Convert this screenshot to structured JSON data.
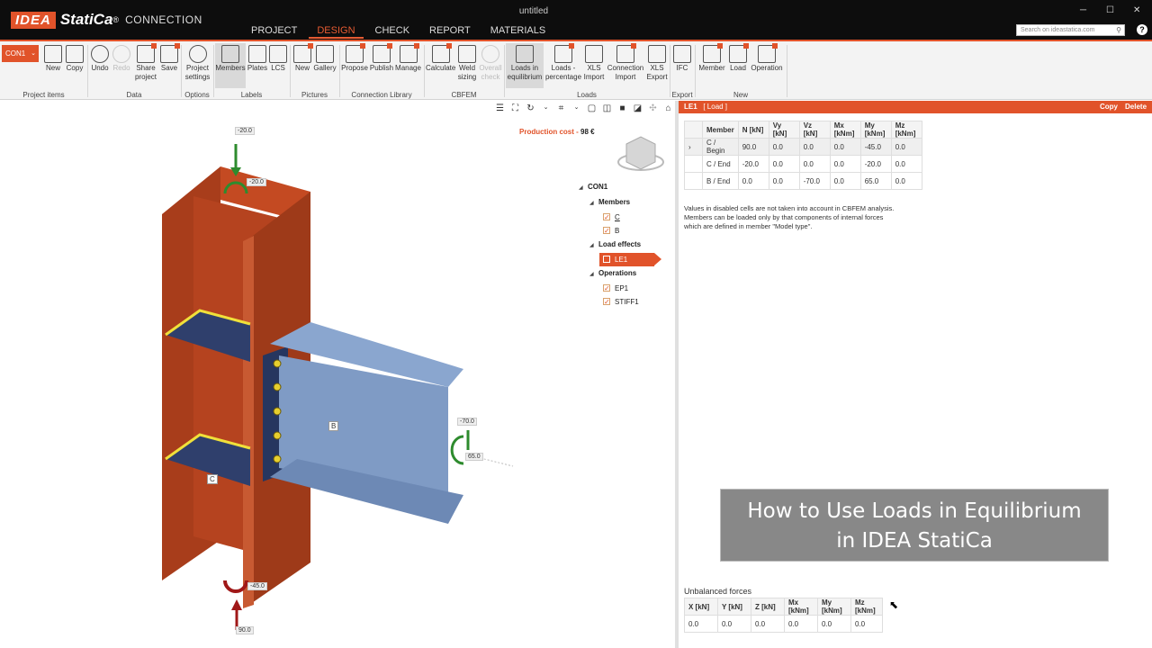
{
  "app": {
    "logo_brand": "IDEA",
    "logo_name": "StatiCa",
    "logo_reg": "®",
    "module": "CONNECTION",
    "window_title": "untitled"
  },
  "menu": [
    {
      "label": "PROJECT"
    },
    {
      "label": "DESIGN"
    },
    {
      "label": "CHECK"
    },
    {
      "label": "REPORT"
    },
    {
      "label": "MATERIALS"
    }
  ],
  "search": {
    "placeholder": "Search on ideastatica.com"
  },
  "ribbon": {
    "connection_selector": "CON1",
    "buttons": {
      "new": "New",
      "copy": "Copy",
      "undo": "Undo",
      "redo": "Redo",
      "share_project": "Share project",
      "save": "Save",
      "project_settings": "Project settings",
      "members": "Members",
      "plates": "Plates",
      "lcs": "LCS",
      "new_picture": "New",
      "gallery": "Gallery",
      "propose": "Propose",
      "publish": "Publish",
      "manage": "Manage",
      "calculate": "Calculate",
      "weld_sizing": "Weld sizing",
      "overall_check": "Overall check",
      "loads_in_equilibrium": "Loads in equilibrium",
      "loads_percentage": "Loads - percentage",
      "xls_import": "XLS Import",
      "connection_import": "Connection Import",
      "xls_export": "XLS Export",
      "ifc": "IFC",
      "member": "Member",
      "load": "Load",
      "operation": "Operation"
    },
    "groups": {
      "project_items": "Project items",
      "data": "Data",
      "options": "Options",
      "labels": "Labels",
      "pictures": "Pictures",
      "connection_library": "Connection Library",
      "cbfem": "CBFEM",
      "loads": "Loads",
      "export": "Export",
      "new": "New"
    }
  },
  "viewport": {
    "production_cost_label": "Production cost",
    "production_cost_value": "98 €",
    "member_labels": {
      "b": "B",
      "c": "C"
    },
    "load_values": {
      "top_force": "-20.0",
      "top_moment": "-20.0",
      "bottom_moment": "-45.0",
      "bottom_force": "90.0",
      "b_force": "-70.0",
      "b_moment": "65.0"
    }
  },
  "tree": {
    "root": "CON1",
    "members_label": "Members",
    "members": [
      "C",
      "B"
    ],
    "load_effects_label": "Load effects",
    "load_effects": [
      "LE1"
    ],
    "operations_label": "Operations",
    "operations": [
      "EP1",
      "STIFF1"
    ]
  },
  "load_panel": {
    "header_id": "LE1",
    "header_type": "[ Load ]",
    "copy": "Copy",
    "delete": "Delete",
    "columns": [
      "Member",
      "N [kN]",
      "Vy [kN]",
      "Vz [kN]",
      "Mx [kNm]",
      "My [kNm]",
      "Mz [kNm]"
    ],
    "rows": [
      {
        "member": "C / Begin",
        "N": "90.0",
        "Vy": "0.0",
        "Vz": "0.0",
        "Mx": "0.0",
        "My": "-45.0",
        "Mz": "0.0"
      },
      {
        "member": "C / End",
        "N": "-20.0",
        "Vy": "0.0",
        "Vz": "0.0",
        "Mx": "0.0",
        "My": "-20.0",
        "Mz": "0.0"
      },
      {
        "member": "B / End",
        "N": "0.0",
        "Vy": "0.0",
        "Vz": "-70.0",
        "Mx": "0.0",
        "My": "65.0",
        "Mz": "0.0"
      }
    ],
    "note": "Values in disabled cells are not taken into account in CBFEM analysis. Members can be loaded only by that components of internal forces which are defined in member \"Model type\"."
  },
  "caption": {
    "line1": "How to Use Loads in Equilibrium",
    "line2": "in IDEA StatiCa"
  },
  "unbalanced": {
    "title": "Unbalanced forces",
    "columns": [
      "X [kN]",
      "Y [kN]",
      "Z [kN]",
      "Mx [kNm]",
      "My [kNm]",
      "Mz [kNm]"
    ],
    "values": [
      "0.0",
      "0.0",
      "0.0",
      "0.0",
      "0.0",
      "0.0"
    ]
  },
  "colors": {
    "accent": "#e1532a",
    "column_steel": "#b5431f",
    "beam_steel": "#7a96c0",
    "plates": "#3a4b7a",
    "welds": "#f0e03a"
  }
}
